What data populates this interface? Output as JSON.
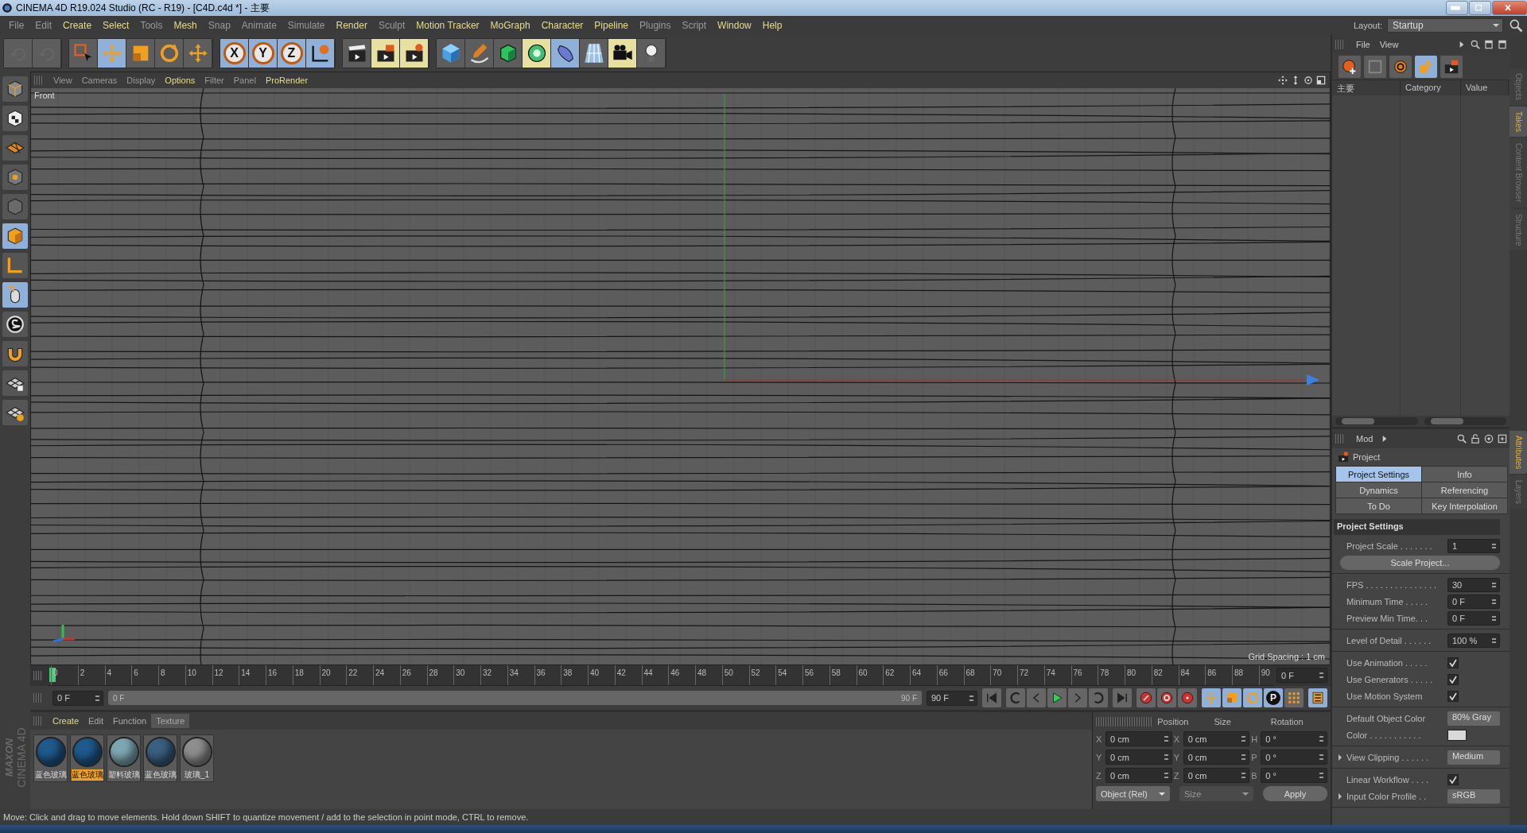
{
  "window": {
    "title": "CINEMA 4D R19.024 Studio (RC - R19) - [C4D.c4d *] - 主要"
  },
  "menu": [
    {
      "label": "File",
      "highlighted": false
    },
    {
      "label": "Edit",
      "highlighted": false
    },
    {
      "label": "Create",
      "highlighted": true
    },
    {
      "label": "Select",
      "highlighted": true
    },
    {
      "label": "Tools",
      "highlighted": false
    },
    {
      "label": "Mesh",
      "highlighted": true
    },
    {
      "label": "Snap",
      "highlighted": false
    },
    {
      "label": "Animate",
      "highlighted": false
    },
    {
      "label": "Simulate",
      "highlighted": false
    },
    {
      "label": "Render",
      "highlighted": true
    },
    {
      "label": "Sculpt",
      "highlighted": false
    },
    {
      "label": "Motion Tracker",
      "highlighted": true
    },
    {
      "label": "MoGraph",
      "highlighted": true
    },
    {
      "label": "Character",
      "highlighted": true
    },
    {
      "label": "Pipeline",
      "highlighted": true
    },
    {
      "label": "Plugins",
      "highlighted": false
    },
    {
      "label": "Script",
      "highlighted": false
    },
    {
      "label": "Window",
      "highlighted": true
    },
    {
      "label": "Help",
      "highlighted": true
    }
  ],
  "layout": {
    "label": "Layout:",
    "value": "Startup"
  },
  "toolbar": {
    "axis_buttons": [
      {
        "label": "X"
      },
      {
        "label": "Y"
      },
      {
        "label": "Z"
      }
    ]
  },
  "viewport": {
    "menu": [
      {
        "label": "View",
        "highlighted": false
      },
      {
        "label": "Cameras",
        "highlighted": false
      },
      {
        "label": "Display",
        "highlighted": false
      },
      {
        "label": "Options",
        "highlighted": true
      },
      {
        "label": "Filter",
        "highlighted": false
      },
      {
        "label": "Panel",
        "highlighted": false
      },
      {
        "label": "ProRender",
        "highlighted": true
      }
    ],
    "camera": "Front",
    "grid_spacing": "Grid Spacing : 1 cm"
  },
  "timeline": {
    "ticks": [
      "0",
      "2",
      "4",
      "6",
      "8",
      "10",
      "12",
      "14",
      "16",
      "18",
      "20",
      "22",
      "24",
      "26",
      "28",
      "30",
      "32",
      "34",
      "36",
      "38",
      "40",
      "42",
      "44",
      "46",
      "48",
      "50",
      "52",
      "54",
      "56",
      "58",
      "60",
      "62",
      "64",
      "66",
      "68",
      "70",
      "72",
      "74",
      "76",
      "78",
      "80",
      "82",
      "84",
      "86",
      "88",
      "90"
    ],
    "playhead": {
      "level": 0
    },
    "current": "0 F"
  },
  "transport": {
    "start": "0 F",
    "range_start": "0 F",
    "range_end": "90 F",
    "end": "90 F",
    "param_key": "P"
  },
  "materials": {
    "tabs": [
      {
        "label": "Create",
        "highlighted": true,
        "selected": false
      },
      {
        "label": "Edit",
        "highlighted": false,
        "selected": false
      },
      {
        "label": "Function",
        "highlighted": false,
        "selected": false
      },
      {
        "label": "Texture",
        "highlighted": false,
        "selected": true
      }
    ],
    "items": [
      {
        "label": "蓝色玻璃",
        "selected": false,
        "color": "#1e5a8c"
      },
      {
        "label": "蓝色玻璃",
        "selected": true,
        "color": "#1e5a8c"
      },
      {
        "label": "塑料玻璃",
        "selected": false,
        "color": "#7ea6b2"
      },
      {
        "label": "蓝色玻璃",
        "selected": false,
        "color": "#3a5f80"
      },
      {
        "label": "玻璃_1",
        "selected": false,
        "color": "#8e8e8e"
      }
    ],
    "logo": [
      "MAXON",
      "CINEMA 4D"
    ]
  },
  "coordinates": {
    "headers": [
      "Position",
      "Size",
      "Rotation"
    ],
    "rows": [
      {
        "pos_axis": "X",
        "pos": "0 cm",
        "size_axis": "X",
        "size": "0 cm",
        "rot_axis": "H",
        "rot": "0 °"
      },
      {
        "pos_axis": "Y",
        "pos": "0 cm",
        "size_axis": "Y",
        "size": "0 cm",
        "rot_axis": "P",
        "rot": "0 °"
      },
      {
        "pos_axis": "Z",
        "pos": "0 cm",
        "size_axis": "Z",
        "size": "0 cm",
        "rot_axis": "B",
        "rot": "0 °"
      }
    ],
    "mode": {
      "value": "Object (Rel)",
      "disabled": false
    },
    "size_mode": {
      "value": "Size",
      "disabled": true
    },
    "apply": "Apply"
  },
  "status_bar": "Move: Click and drag to move elements. Hold down SHIFT to quantize movement / add to the selection in point mode, CTRL to remove.",
  "objects_panel": {
    "menu": [
      "File",
      "View"
    ],
    "columns": [
      "主要",
      "Category",
      "Value"
    ]
  },
  "side_tabs_top": [
    {
      "label": "Objects",
      "selected": false
    },
    {
      "label": "Takes",
      "selected": true
    },
    {
      "label": "Content Browser",
      "selected": false
    },
    {
      "label": "Structure",
      "selected": false
    }
  ],
  "side_tabs_bottom": [
    {
      "label": "Attributes",
      "selected": true
    },
    {
      "label": "Layers",
      "selected": false
    }
  ],
  "attributes": {
    "menu": "Mod",
    "object": "Project",
    "tabs": [
      {
        "label": "Project Settings",
        "selected": true
      },
      {
        "label": "Info",
        "selected": false
      },
      {
        "label": "Dynamics",
        "selected": false
      },
      {
        "label": "Referencing",
        "selected": false
      },
      {
        "label": "To Do",
        "selected": false
      },
      {
        "label": "Key Interpolation",
        "selected": false
      }
    ],
    "section": "Project Settings",
    "groups": [
      [
        {
          "kind": "field",
          "label": "Project Scale . . . . . . .",
          "value": "1",
          "expandable": false
        },
        {
          "kind": "button",
          "label": "Scale Project..."
        }
      ],
      [
        {
          "kind": "field",
          "label": "FPS . . . . . . . . . . . . . . .",
          "value": "30",
          "expandable": false
        },
        {
          "kind": "field",
          "label": "Minimum Time . . . . .",
          "value": "0 F",
          "expandable": false
        },
        {
          "kind": "field",
          "label": "Preview Min Time. . .",
          "value": "0 F",
          "expandable": false
        }
      ],
      [
        {
          "kind": "field",
          "label": "Level of Detail . . . . . .",
          "value": "100 %",
          "expandable": false
        }
      ],
      [
        {
          "kind": "check",
          "label": "Use Animation . . . . .",
          "checked": true,
          "expandable": false
        },
        {
          "kind": "check",
          "label": "Use Generators . . . . .",
          "checked": true,
          "expandable": false
        },
        {
          "kind": "check",
          "label": "Use Motion System",
          "checked": true,
          "expandable": false
        }
      ],
      [
        {
          "kind": "dropdown",
          "label": "Default Object Color",
          "value": "80% Gray",
          "expandable": false
        },
        {
          "kind": "color",
          "label": "Color . . . . . . . . . . .",
          "color": "#d9d9d9",
          "expandable": false
        }
      ],
      [
        {
          "kind": "dropdown",
          "label": "View Clipping . . . . . .",
          "value": "Medium",
          "expandable": true
        }
      ],
      [
        {
          "kind": "check",
          "label": "Linear Workflow . . . .",
          "checked": true,
          "expandable": false
        },
        {
          "kind": "dropdown",
          "label": "Input Color Profile . .",
          "value": "sRGB",
          "expandable": true
        }
      ]
    ]
  }
}
